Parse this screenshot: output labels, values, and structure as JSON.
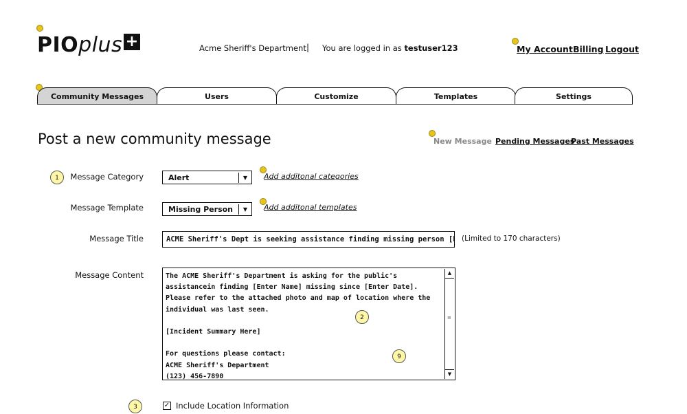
{
  "header": {
    "logo_text": "PIO",
    "logo_suffix": "plus",
    "logo_symbol": "+",
    "department": "Acme Sheriff's Department",
    "separator": "|",
    "logged_in_prefix": "You are logged in as",
    "username": "testuser123",
    "links": {
      "my_account": "My Account",
      "billing": "Billing",
      "logout": "Logout"
    }
  },
  "tabs": [
    {
      "label": "Community Messages",
      "active": true
    },
    {
      "label": "Users",
      "active": false
    },
    {
      "label": "Customize",
      "active": false
    },
    {
      "label": "Templates",
      "active": false
    },
    {
      "label": "Settings",
      "active": false
    }
  ],
  "page": {
    "title": "Post a new community message",
    "subnav": {
      "new_message": "New Message",
      "pending_messages": "Pending Messages",
      "past_messages": "Past Messages"
    }
  },
  "form": {
    "category": {
      "label": "Message Category",
      "value": "Alert",
      "add_link": "Add additonal categories"
    },
    "template": {
      "label": "Message Template",
      "value": "Missing Person",
      "add_link": "Add additonal templates"
    },
    "title": {
      "label": "Message Title",
      "value": "ACME Sheriff's Dept is seeking assistance finding missing person [Enter Name]",
      "limit_note": "(Limited to 170 characters)"
    },
    "content": {
      "label": "Message Content",
      "value": "The ACME Sheriff's Department is asking for the public's assistancein finding [Enter Name] missing since [Enter Date].  Please refer to the attached photo and map of location where the individual was last seen.\n\n[Incident Summary Here]\n\nFor questions please contact:\nACME Sheriff's Department\n(123) 456-7890"
    },
    "location": {
      "label": "Include Location Information",
      "checked": true,
      "check_glyph": "✓"
    }
  },
  "annotations": [
    "1",
    "2",
    "9",
    "3"
  ],
  "icons": {
    "dropdown": "▼",
    "scroll_up": "▲",
    "scroll_down": "▼",
    "grip": "≡"
  }
}
